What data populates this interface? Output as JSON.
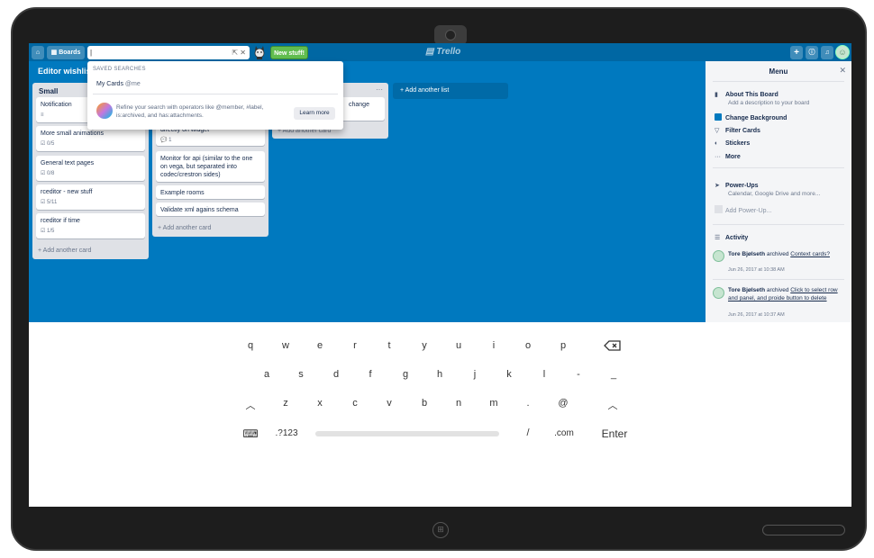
{
  "header": {
    "boards_label": "Boards",
    "search_value": "|",
    "new_stuff_label": "New stuff!",
    "logo": "Trello"
  },
  "board": {
    "title": "Editor wishlis"
  },
  "lists": [
    {
      "title": "Small",
      "cards": [
        {
          "text": "Notification",
          "badge": "≡"
        },
        {
          "text": "More small animations",
          "badge": "☑ 0/5"
        },
        {
          "text": "General text pages",
          "badge": "☑ 0/8"
        },
        {
          "text": "rceditor - new stuff",
          "badge": "☑ 5/11"
        },
        {
          "text": "rceditor if time",
          "badge": "☑ 1/5"
        }
      ],
      "add_card": "+ Add another card"
    },
    {
      "title": "",
      "cards": [
        {
          "text": "directly on widget",
          "badge": "💬 1"
        },
        {
          "text": "Monitor for api (similar to the one on vega, but separated into codec/crestron sides)",
          "badge": ""
        },
        {
          "text": "Example rooms",
          "badge": ""
        },
        {
          "text": "Validate xml agains schema",
          "badge": ""
        }
      ],
      "add_card": "+ Add another card"
    },
    {
      "title": "",
      "cards": [
        {
          "text": "change (and",
          "badge": ""
        }
      ],
      "add_card": "+ Add another card"
    }
  ],
  "add_list": "+ Add another list",
  "dropdown": {
    "heading": "SAVED SEARCHES",
    "item_label": "My Cards",
    "item_query": "@me",
    "tip": "Refine your search with operators like @member, #label, is:archived, and has:attachments.",
    "learn_more": "Learn more"
  },
  "menu": {
    "title": "Menu",
    "about_title": "About This Board",
    "about_sub": "Add a description to your board",
    "change_bg": "Change Background",
    "filter_cards": "Filter Cards",
    "stickers": "Stickers",
    "more": "More",
    "powerups_title": "Power-Ups",
    "powerups_sub": "Calendar, Google Drive and more...",
    "add_powerup": "Add Power-Up...",
    "activity_title": "Activity",
    "activity": [
      {
        "user": "Tore Bjølseth",
        "action": " archived ",
        "target": "Context cards?",
        "date": "Jun 26, 2017 at 10:38 AM"
      },
      {
        "user": "Tore Bjølseth",
        "action": " archived ",
        "target": "Click to select row and panel, and proide button to delete",
        "date": "Jun 26, 2017 at 10:37 AM"
      }
    ]
  },
  "keyboard": {
    "row1": [
      "q",
      "w",
      "e",
      "r",
      "t",
      "y",
      "u",
      "i",
      "o",
      "p"
    ],
    "row2": [
      "a",
      "s",
      "d",
      "f",
      "g",
      "h",
      "j",
      "k",
      "l",
      "-",
      "_"
    ],
    "row3": [
      "z",
      "x",
      "c",
      "v",
      "b",
      "n",
      "m",
      ".",
      "@"
    ],
    "numbers_label": ".?123",
    "slash": "/",
    "dotcom": ".com",
    "enter": "Enter"
  }
}
